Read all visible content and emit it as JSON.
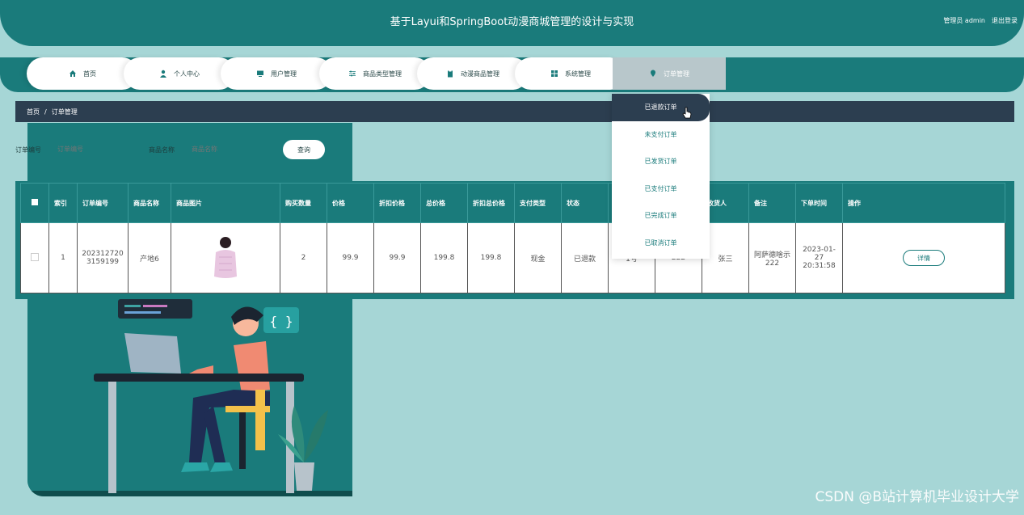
{
  "header": {
    "title": "基于Layui和SpringBoot动漫商城管理的设计与实现",
    "user_label": "管理员 admin",
    "logout": "退出登录"
  },
  "nav": {
    "items": [
      {
        "label": "首页",
        "icon": "home-icon"
      },
      {
        "label": "个人中心",
        "icon": "person-icon"
      },
      {
        "label": "用户管理",
        "icon": "monitor-icon"
      },
      {
        "label": "商品类型管理",
        "icon": "sliders-icon"
      },
      {
        "label": "动漫商品管理",
        "icon": "clipboard-icon"
      },
      {
        "label": "系统管理",
        "icon": "grid-icon"
      },
      {
        "label": "订单管理",
        "icon": "location-pin-icon"
      }
    ]
  },
  "breadcrumb": {
    "home": "首页",
    "sep": "/",
    "current": "订单管理"
  },
  "search": {
    "order_no_label": "订单编号",
    "order_no_placeholder": "订单编号",
    "product_label": "商品名称",
    "product_placeholder": "商品名称",
    "button": "查询"
  },
  "dropdown": {
    "items": [
      "已退款订单",
      "未支付订单",
      "已发货订单",
      "已支付订单",
      "已完成订单",
      "已取消订单"
    ]
  },
  "table": {
    "headers": [
      "索引",
      "订单编号",
      "商品名称",
      "商品图片",
      "购买数量",
      "价格",
      "折扣价格",
      "总价格",
      "折扣总价格",
      "支付类型",
      "状态",
      "",
      "",
      "收货人",
      "备注",
      "下单时间",
      "操作"
    ],
    "row": {
      "index": "1",
      "order_no": "2023127203159199",
      "product": "产地6",
      "qty": "2",
      "price": "99.9",
      "discount_price": "99.9",
      "total": "199.8",
      "discount_total": "199.8",
      "pay_type": "现金",
      "status": "已退款",
      "addr": "1号",
      "phone": "222",
      "receiver": "张三",
      "remark": "阿萨德啥示222",
      "time": "2023-01-27 20:31:58",
      "action": "详情"
    }
  },
  "watermark": "CSDN @B站计算机毕业设计大学"
}
